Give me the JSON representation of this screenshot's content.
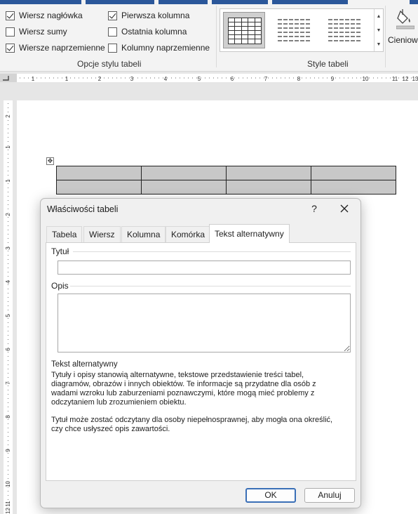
{
  "ribbon": {
    "options": {
      "header_row": {
        "label": "Wiersz nagłówka",
        "checked": true
      },
      "total_row": {
        "label": "Wiersz sumy",
        "checked": false
      },
      "banded_rows": {
        "label": "Wiersze naprzemienne",
        "checked": true
      },
      "first_column": {
        "label": "Pierwsza kolumna",
        "checked": true
      },
      "last_column": {
        "label": "Ostatnia kolumna",
        "checked": false
      },
      "banded_columns": {
        "label": "Kolumny naprzemienne",
        "checked": false
      }
    },
    "group_options_label": "Opcje stylu tabeli",
    "group_styles_label": "Style tabeli",
    "shading_label": "Cieniow",
    "accent_color": "#2b579a"
  },
  "ruler": {
    "h_numbers": [
      "1",
      "1",
      "2",
      "3",
      "4",
      "5",
      "6",
      "7",
      "8",
      "9",
      "10",
      "11",
      "12",
      "13"
    ],
    "v_numbers": [
      "2",
      "1",
      "1",
      "2",
      "3",
      "4",
      "5",
      "6",
      "7",
      "8",
      "9",
      "10",
      "11",
      "12",
      "13"
    ]
  },
  "dialog": {
    "title": "Właściwości tabeli",
    "help_glyph": "?",
    "tabs": [
      "Tabela",
      "Wiersz",
      "Kolumna",
      "Komórka",
      "Tekst alternatywny"
    ],
    "title_field_label": "Tytuł",
    "title_value": "",
    "description_label": "Opis",
    "description_value": "",
    "help_heading": "Tekst alternatywny",
    "help_lines": [
      "Tytuły i opisy stanowią alternatywne, tekstowe przedstawienie treści tabel,",
      "diagramów, obrazów i innych obiektów. Te informacje są przydatne dla osób z",
      "wadami wzroku lub zaburzeniami poznawczymi, które mogą mieć problemy z",
      "odczytaniem lub zrozumieniem obiektu."
    ],
    "help_lines_2": [
      "Tytuł może zostać odczytany dla osoby niepełnosprawnej, aby mogła ona określić,",
      "czy chce usłyszeć opis zawartości."
    ],
    "ok_label": "OK",
    "cancel_label": "Anuluj"
  }
}
